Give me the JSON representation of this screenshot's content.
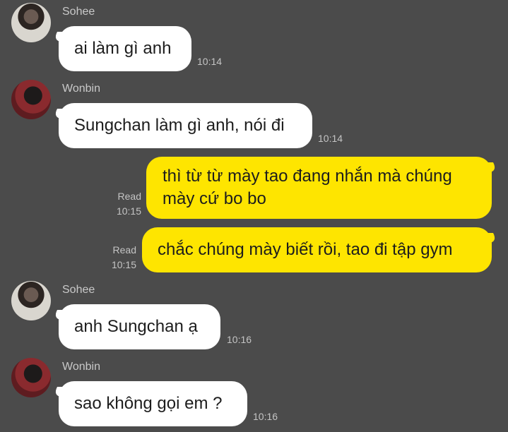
{
  "messages": [
    {
      "sender": "Sohee",
      "text": "ai làm gì anh",
      "time": "10:14"
    },
    {
      "sender": "Wonbin",
      "text": "Sungchan làm gì anh, nói đi",
      "time": "10:14"
    },
    {
      "text_line1": "thì từ từ mày tao đang nhắn mà chúng",
      "text_line2": "mày cứ bo bo",
      "read": "Read",
      "time": "10:15"
    },
    {
      "text": "chắc chúng mày biết rồi, tao đi tập gym",
      "read": "Read",
      "time": "10:15"
    },
    {
      "sender": "Sohee",
      "text": "anh Sungchan ạ",
      "time": "10:16"
    },
    {
      "sender": "Wonbin",
      "text": "sao không gọi em ?",
      "time": "10:16"
    }
  ]
}
